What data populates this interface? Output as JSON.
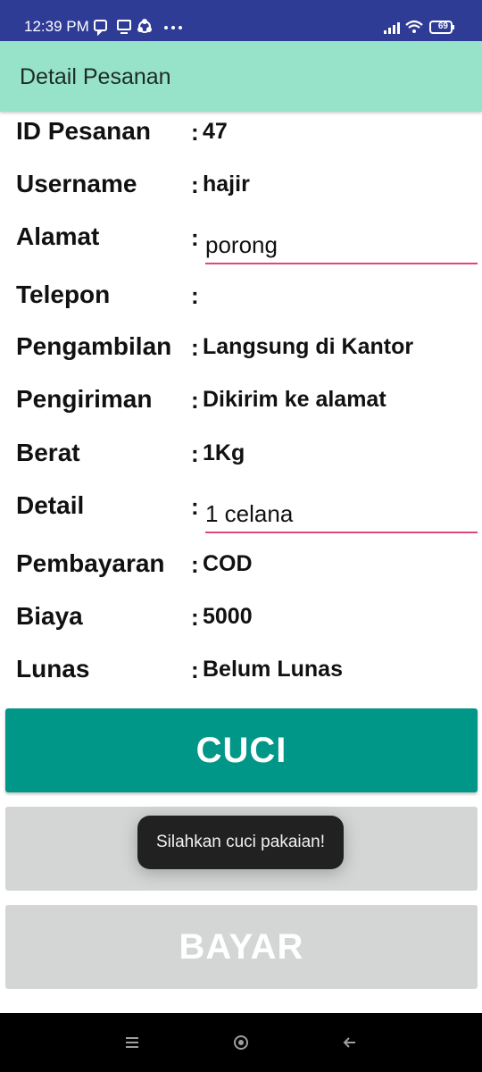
{
  "status_bar": {
    "time": "12:39 PM",
    "battery": "69",
    "icons_left": [
      "message-icon",
      "screen-icon",
      "sync-icon",
      "more-icon"
    ],
    "icons_right": [
      "signal-icon",
      "wifi-icon",
      "battery-icon"
    ]
  },
  "app_bar": {
    "title": "Detail Pesanan",
    "background": "#96e3c9"
  },
  "details": {
    "id_pesanan": {
      "label": "ID Pesanan",
      "colon": ":",
      "value": "47"
    },
    "username": {
      "label": "Username",
      "colon": ":",
      "value": "hajir"
    },
    "alamat": {
      "label": "Alamat",
      "colon": ":",
      "value": "porong"
    },
    "telepon": {
      "label": "Telepon",
      "colon": ":",
      "value": ""
    },
    "pengambilan": {
      "label": "Pengambilan",
      "colon": ":",
      "value": "Langsung di Kantor"
    },
    "pengiriman": {
      "label": "Pengiriman",
      "colon": ":",
      "value": "Dikirim ke alamat"
    },
    "berat": {
      "label": "Berat",
      "colon": ":",
      "value": "1Kg"
    },
    "detail": {
      "label": "Detail",
      "colon": ":",
      "value": "1 celana"
    },
    "pembayaran": {
      "label": "Pembayaran",
      "colon": ":",
      "value": "COD"
    },
    "biaya": {
      "label": "Biaya",
      "colon": ":",
      "value": "5000"
    },
    "lunas": {
      "label": "Lunas",
      "colon": ":",
      "value": "Belum Lunas"
    }
  },
  "buttons": {
    "cuci_label": "CUCI",
    "middle_label": "",
    "bayar_label": "BAYAR"
  },
  "toast": {
    "message": "Silahkan cuci pakaian!"
  },
  "colors": {
    "status_bar": "#2f3c96",
    "primary_button": "#009688",
    "disabled_button": "#d4d6d6",
    "input_underline": "#e2457a"
  },
  "nav_bar": {
    "icons": [
      "menu-icon",
      "home-icon",
      "back-icon"
    ]
  }
}
